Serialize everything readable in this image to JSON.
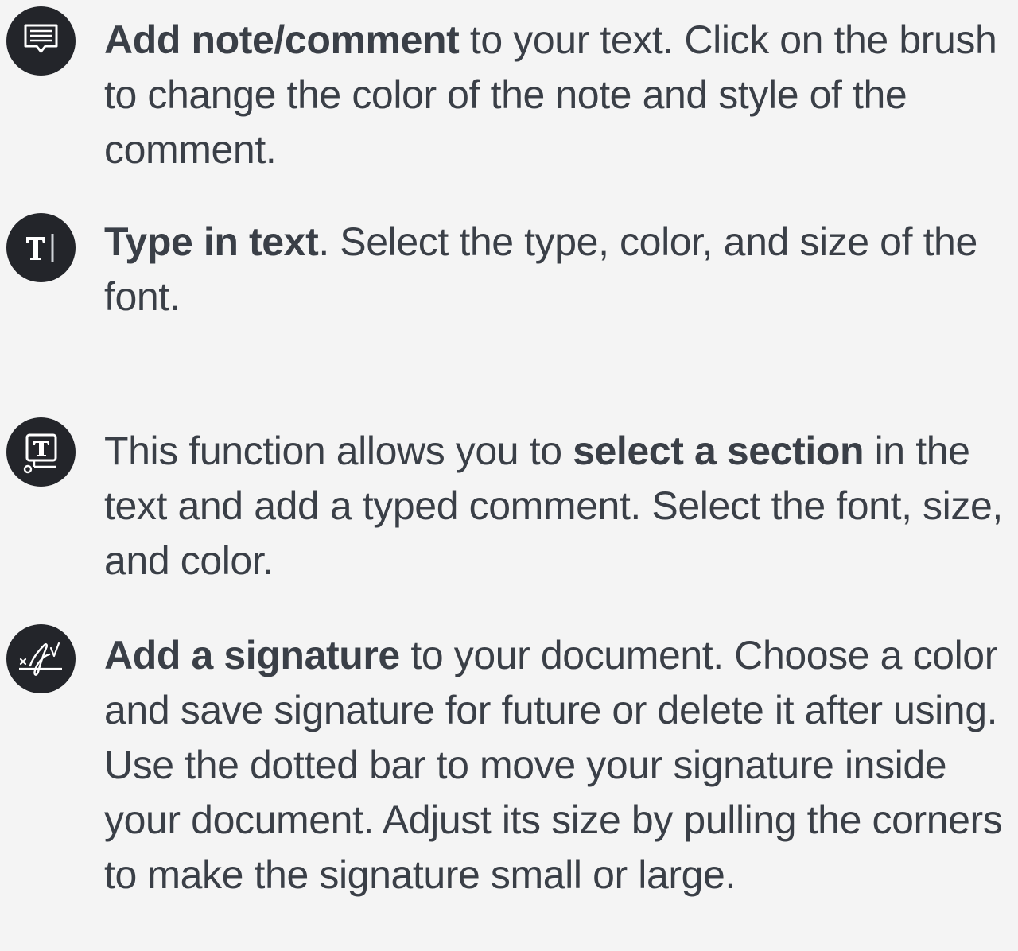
{
  "items": [
    {
      "id": "note",
      "icon": "note-comment-icon",
      "bold": "Add note/comment",
      "before": "",
      "after": " to your text. Click on the brush to change the color of the note and style of the comment."
    },
    {
      "id": "type",
      "icon": "type-text-icon",
      "bold": "Type in text",
      "before": "",
      "after": ". Select the type, color, and size of the font."
    },
    {
      "id": "section",
      "icon": "text-callout-icon",
      "before": "This function allows you to ",
      "bold": "select a section",
      "after": " in the text and add a typed comment. Select the font, size, and color."
    },
    {
      "id": "signature",
      "icon": "signature-icon",
      "bold": "Add a signature",
      "before": "",
      "after": " to your document. Choose a color and save signature for future or delete it after using. Use the dotted bar to move your signature inside your document. Adjust its size by pulling the corners to make the signature small or large."
    }
  ],
  "colors": {
    "background": "#f4f4f4",
    "icon_circle": "#23252a",
    "text": "#3a3f47"
  }
}
